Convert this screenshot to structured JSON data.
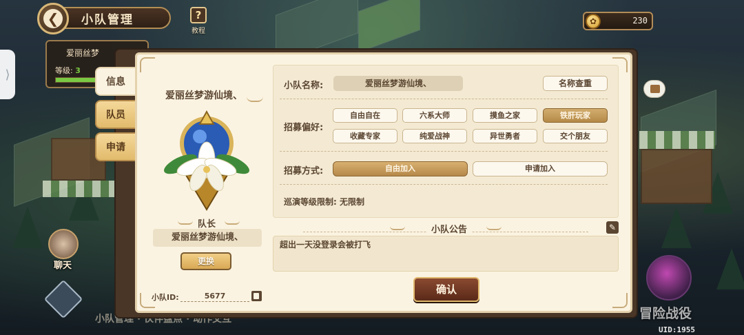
{
  "header": {
    "title": "小队管理",
    "tutorial_label": "教程",
    "tutorial_icon": "?",
    "currency_value": "230"
  },
  "background": {
    "card_name": "爱丽丝梦",
    "card_level_label": "等级:",
    "card_level_value": "3",
    "chat_label": "聊天",
    "bottom_hint": "小队管理 · 伙伴盘点 · 动作交互",
    "adventure_label": "冒险战役",
    "uid_text": "UID:1955"
  },
  "tabs": [
    {
      "label": "信息",
      "active": true
    },
    {
      "label": "队员",
      "active": false
    },
    {
      "label": "申请",
      "active": false
    }
  ],
  "team": {
    "title": "爱丽丝梦游仙境、",
    "captain_label": "队长",
    "captain_name": "爱丽丝梦游仙境、",
    "swap_button": "更换",
    "id_label": "小队ID:",
    "id_value": "5677"
  },
  "form": {
    "name_label": "小队名称:",
    "name_value": "爱丽丝梦游仙境、",
    "name_check_button": "名称查重",
    "pref_label": "招募偏好:",
    "preferences": [
      {
        "label": "自由自在",
        "selected": false
      },
      {
        "label": "六系大师",
        "selected": false
      },
      {
        "label": "摸鱼之家",
        "selected": false
      },
      {
        "label": "铁肝玩家",
        "selected": true
      },
      {
        "label": "收藏专家",
        "selected": false
      },
      {
        "label": "纯爱战神",
        "selected": false
      },
      {
        "label": "异世勇者",
        "selected": false
      },
      {
        "label": "交个朋友",
        "selected": false
      }
    ],
    "mode_label": "招募方式:",
    "mode_options": [
      {
        "label": "自由加入",
        "selected": true
      },
      {
        "label": "申请加入",
        "selected": false
      }
    ],
    "level_limit_text": "巡演等级限制: 无限制"
  },
  "notice": {
    "title": "小队公告",
    "text": "超出一天没登录会被打飞"
  },
  "confirm_button": "确认",
  "colors": {
    "panel_bg": "#fbf3e1",
    "accent_brown": "#5b4632",
    "selected_gold": "#c49a5a",
    "confirm_bg": "#6e3822"
  }
}
